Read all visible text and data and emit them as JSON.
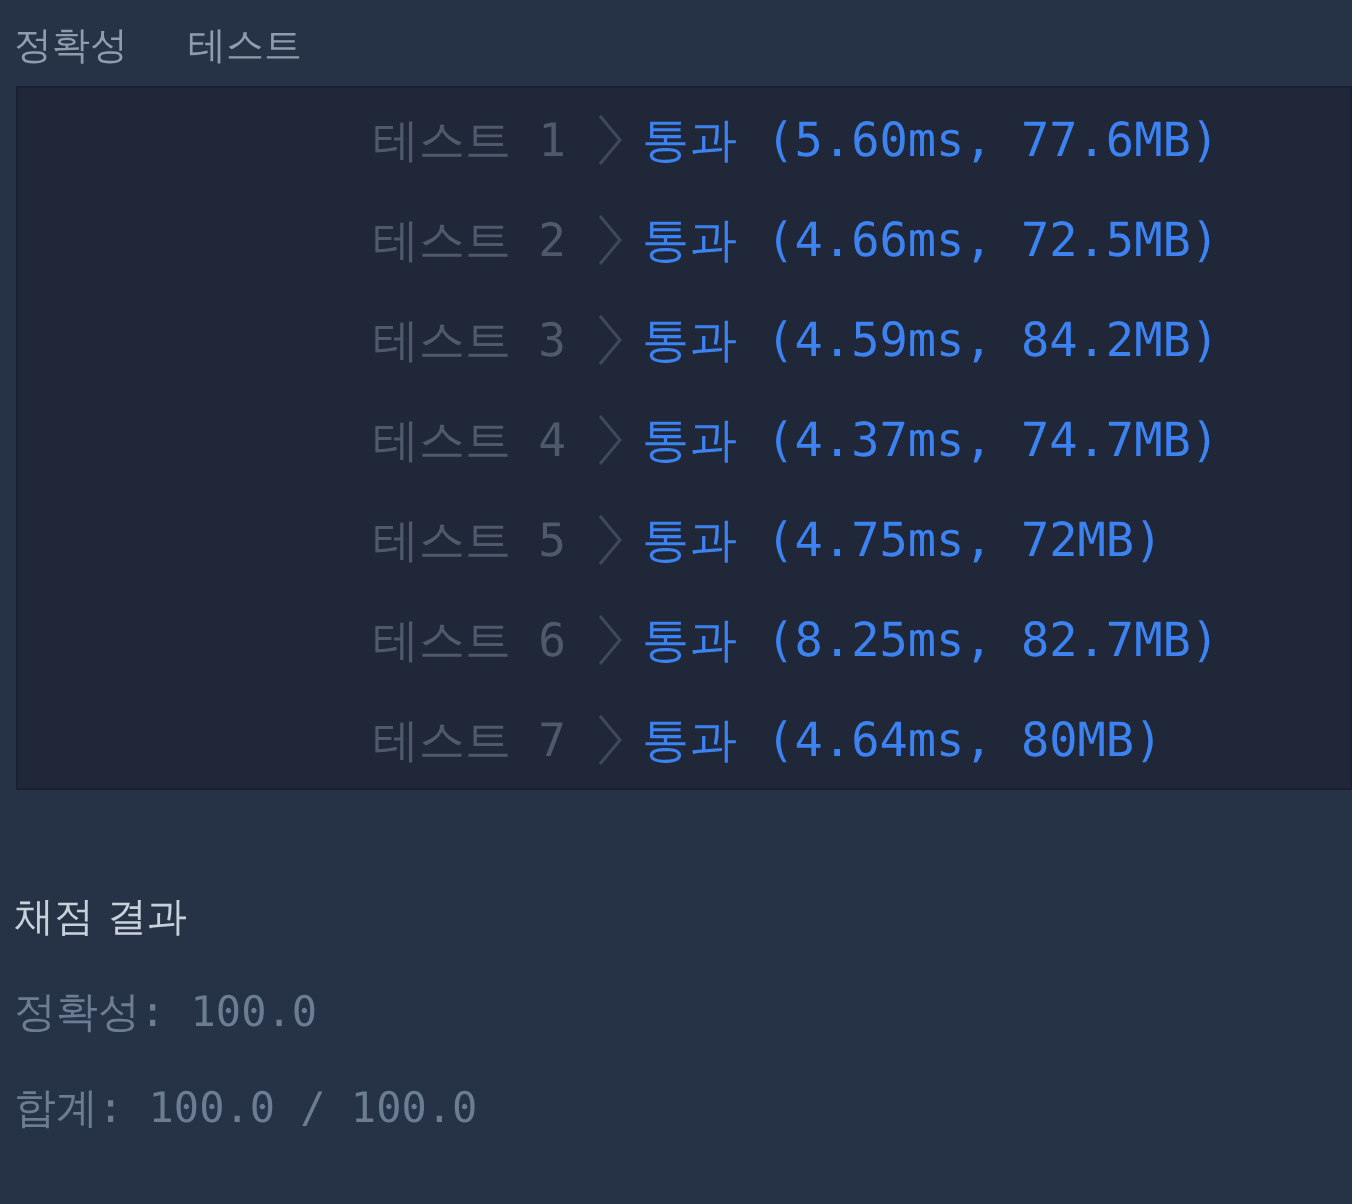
{
  "section_headers": [
    "정확성",
    "테스트"
  ],
  "tests": [
    {
      "label": "테스트",
      "number": "1",
      "result": "통과 (5.60ms, 77.6MB)"
    },
    {
      "label": "테스트",
      "number": "2",
      "result": "통과 (4.66ms, 72.5MB)"
    },
    {
      "label": "테스트",
      "number": "3",
      "result": "통과 (4.59ms, 84.2MB)"
    },
    {
      "label": "테스트",
      "number": "4",
      "result": "통과 (4.37ms, 74.7MB)"
    },
    {
      "label": "테스트",
      "number": "5",
      "result": "통과 (4.75ms, 72MB)"
    },
    {
      "label": "테스트",
      "number": "6",
      "result": "통과 (8.25ms, 82.7MB)"
    },
    {
      "label": "테스트",
      "number": "7",
      "result": "통과 (4.64ms, 80MB)"
    }
  ],
  "grading": {
    "title": "채점 결과",
    "lines": [
      "정확성: 100.0",
      "합계: 100.0 / 100.0"
    ]
  }
}
